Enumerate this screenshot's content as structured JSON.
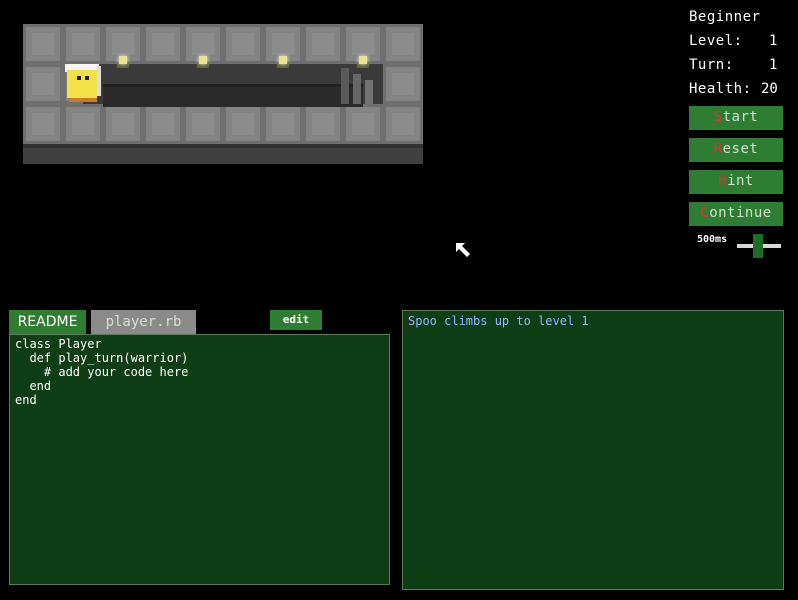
{
  "status": {
    "tower": "Beginner",
    "level_label": "Level:",
    "level_value": "1",
    "turn_label": "Turn:",
    "turn_value": "1",
    "health_label": "Health:",
    "health_value": "20"
  },
  "buttons": {
    "start": {
      "first": "S",
      "rest": "tart"
    },
    "reset": {
      "first": "R",
      "rest": "eset"
    },
    "hint": {
      "first": "H",
      "rest": "int"
    },
    "continue": {
      "first": "C",
      "rest": "ontinue"
    }
  },
  "speed": {
    "label": "500ms"
  },
  "editor": {
    "tabs": {
      "readme": "README",
      "player": "player.rb"
    },
    "edit_label": "edit",
    "code": "class Player\n  def play_turn(warrior)\n    # add your code here\n  end\nend"
  },
  "log": {
    "lines": [
      "Spoo climbs up to level 1"
    ]
  },
  "colors": {
    "button_green": "#2f7d32",
    "panel_green": "#0f3d15",
    "hotkey_red": "#d33",
    "log_blue": "#8fb8ff"
  },
  "icons": {
    "cursor": "arrow-cursor-icon",
    "hero": "warrior-sprite",
    "torch": "torch-icon",
    "stairs": "stairs-icon"
  }
}
